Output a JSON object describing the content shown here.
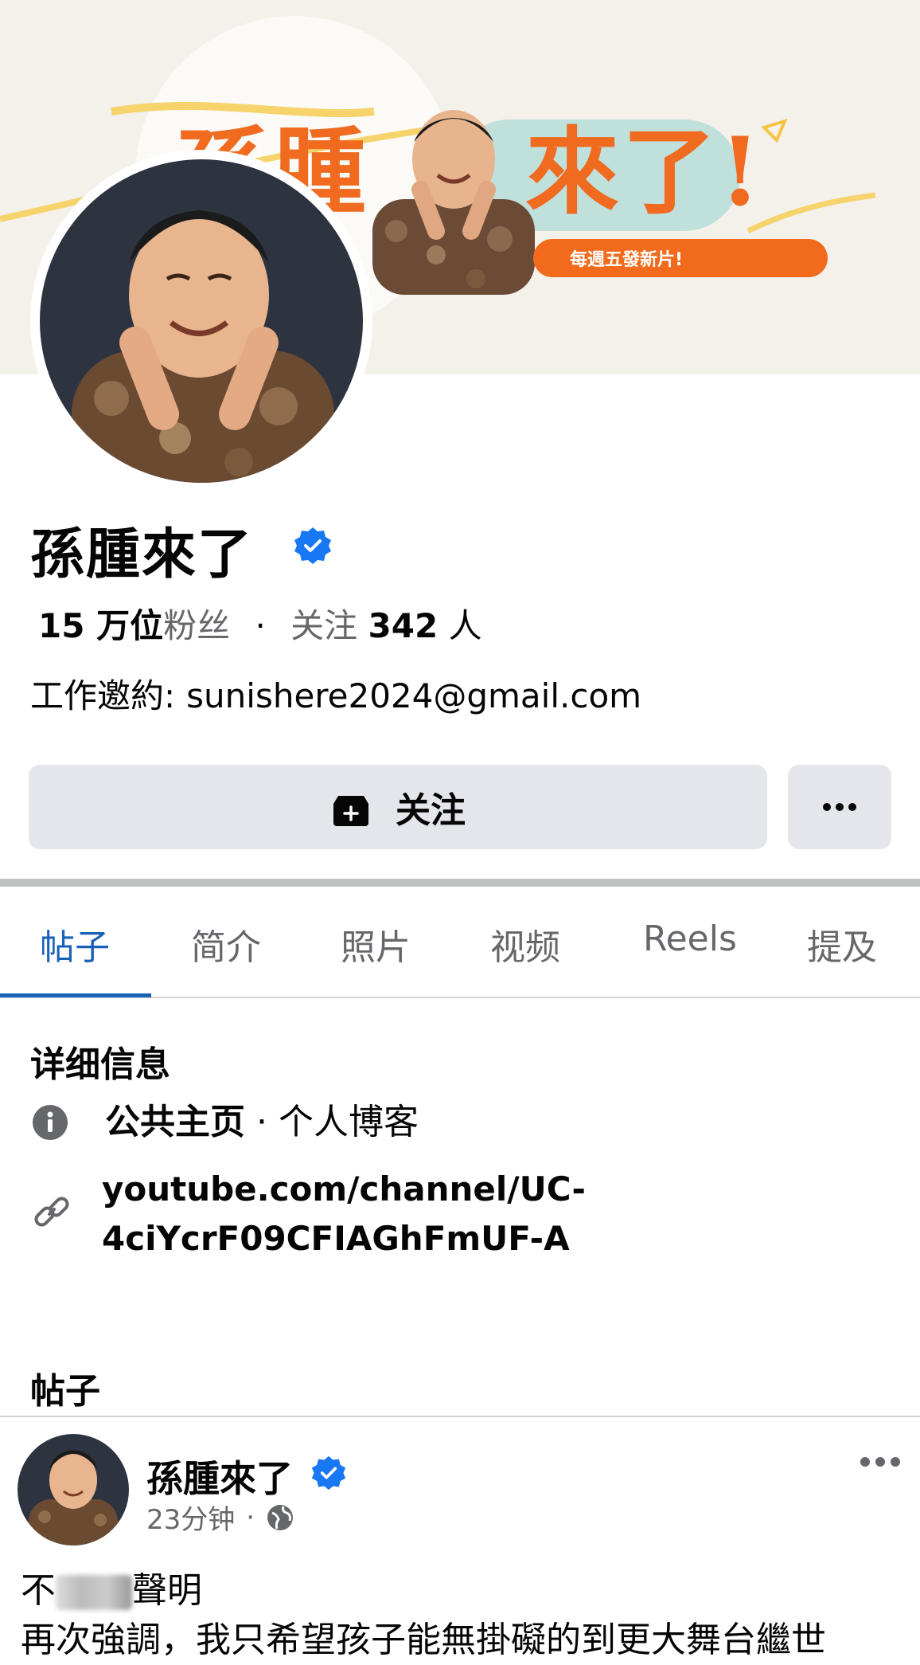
{
  "cover": {
    "title_left": "孫腫",
    "title_right": "來了!",
    "pill_text": "每週五發新片!",
    "colors": {
      "orange": "#f26b1d",
      "teal": "#a9d8d6",
      "cream": "#f4f0ea"
    }
  },
  "profile": {
    "name": "孫腫來了",
    "verified_icon": "verified-badge-icon",
    "followers_count": "15 万位",
    "followers_label": "粉丝",
    "following_label": "关注",
    "following_count": "342",
    "following_unit": "人",
    "work_label": "工作邀約:",
    "work_email": "sunishere2024@gmail.com"
  },
  "actions": {
    "follow_label": "关注",
    "follow_icon": "follow-page-icon",
    "more_icon": "more-horizontal-icon"
  },
  "tabs": [
    {
      "label": "帖子",
      "active": true
    },
    {
      "label": "简介",
      "active": false
    },
    {
      "label": "照片",
      "active": false
    },
    {
      "label": "视频",
      "active": false
    },
    {
      "label": "Reels",
      "active": false
    },
    {
      "label": "提及",
      "active": false
    }
  ],
  "details": {
    "title": "详细信息",
    "category_label": "公共主页",
    "category_value": " · 个人博客",
    "link_line1": "youtube.com/channel/UC-",
    "link_line2": "4ciYcrF09CFIAGhFmUF-A"
  },
  "posts_section": {
    "title": "帖子",
    "post": {
      "author": "孫腫來了",
      "time": "23分钟",
      "separator": "·",
      "audience_icon": "globe-icon",
      "body_start": "不",
      "body_end": "聲明",
      "body_line2": "再次強調，我只希望孩子能無掛礙的到更大舞台繼世"
    }
  },
  "accent_color": "#1a62b8"
}
